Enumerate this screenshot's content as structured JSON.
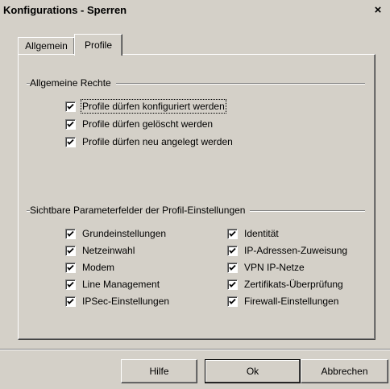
{
  "window": {
    "title": "Konfigurations - Sperren",
    "close_label": "×"
  },
  "tabs": [
    {
      "label": "Allgemein",
      "active": false
    },
    {
      "label": "Profile",
      "active": true
    }
  ],
  "general_rights": {
    "title": "Allgemeine Rechte",
    "items": [
      {
        "label": "Profile dürfen konfiguriert werden",
        "checked": true,
        "focused": true
      },
      {
        "label": "Profile dürfen gelöscht werden",
        "checked": true
      },
      {
        "label": "Profile dürfen neu angelegt werden",
        "checked": true
      }
    ]
  },
  "param_fields": {
    "title": "Sichtbare Parameterfelder der Profil-Einstellungen",
    "left_items": [
      {
        "label": "Grundeinstellungen",
        "checked": true
      },
      {
        "label": "Netzeinwahl",
        "checked": true
      },
      {
        "label": "Modem",
        "checked": true
      },
      {
        "label": "Line Management",
        "checked": true
      },
      {
        "label": "IPSec-Einstellungen",
        "checked": true
      }
    ],
    "right_items": [
      {
        "label": "Identität",
        "checked": true
      },
      {
        "label": "IP-Adressen-Zuweisung",
        "checked": true
      },
      {
        "label": "VPN IP-Netze",
        "checked": true
      },
      {
        "label": "Zertifikats-Überprüfung",
        "checked": true
      },
      {
        "label": "Firewall-Einstellungen",
        "checked": true
      }
    ]
  },
  "buttons": {
    "help": "Hilfe",
    "ok": "Ok",
    "cancel": "Abbrechen"
  }
}
